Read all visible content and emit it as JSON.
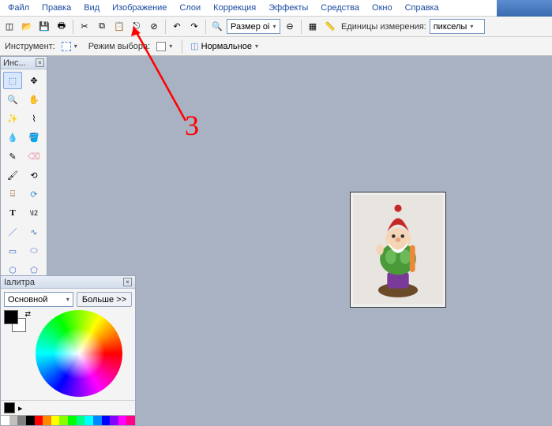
{
  "menu": {
    "file": "Файл",
    "edit": "Правка",
    "view": "Вид",
    "image": "Изображение",
    "layers": "Слои",
    "adjust": "Коррекция",
    "effects": "Эффекты",
    "tools": "Средства",
    "window": "Окно",
    "help": "Справка"
  },
  "toolbar1": {
    "size_label": "Размер оі",
    "units_label": "Единицы измерения:",
    "units_value": "пикселы"
  },
  "toolbar2": {
    "tool_label": "Инструмент:",
    "mode_label": "Режим выбора:",
    "blend_value": "Нормальное"
  },
  "toolbox": {
    "title": "Инс..."
  },
  "palette": {
    "title": "Іалитра",
    "category": "Основной",
    "more": "Больше >>"
  },
  "annotation": {
    "number": "3"
  },
  "icons": {
    "new": "◫",
    "open": "📂",
    "save": "💾",
    "print": "🖶",
    "cut": "✂",
    "copy": "⧉",
    "paste": "📋",
    "undo": "↶",
    "redo": "↷",
    "zoom": "🔍",
    "grid": "▦",
    "ruler": "📏",
    "arrow": "▾"
  },
  "tools": {
    "select": "⬚",
    "move": "✥",
    "zoom": "🔍",
    "hand": "✋",
    "wand": "✨",
    "lasso": "⌇",
    "dropper": "💧",
    "bucket": "🪣",
    "pencil": "✎",
    "eraser": "⌫",
    "brush": "🖌",
    "clone": "⟲",
    "line": "／",
    "curve": "∿",
    "stamp": "⌸",
    "recolor": "⟳",
    "text": "T",
    "text2": "\\I2",
    "rect": "▭",
    "ellipse": "⬭",
    "free": "⬡",
    "shape": "⬠"
  },
  "hues": [
    "#fff",
    "#c0c0c0",
    "#808080",
    "#000",
    "#f00",
    "#f80",
    "#ff0",
    "#8f0",
    "#0f0",
    "#0f8",
    "#0ff",
    "#08f",
    "#00f",
    "#80f",
    "#f0f",
    "#f08"
  ]
}
